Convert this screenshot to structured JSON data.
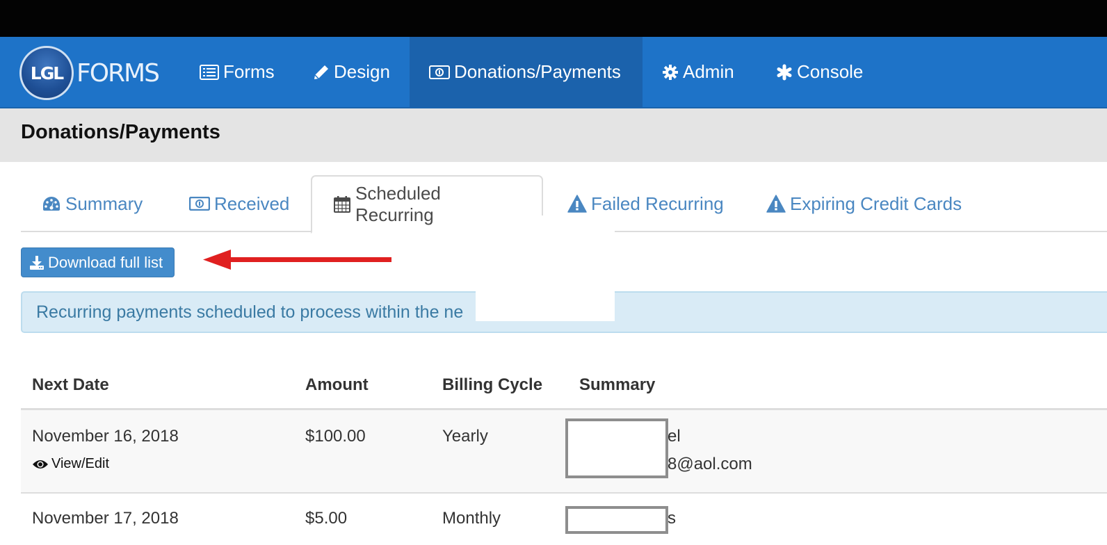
{
  "brand": {
    "logo_mark": "LGL",
    "logo_text": "FORMS"
  },
  "nav": {
    "items": [
      {
        "label": "Forms",
        "icon": "list-icon",
        "active": false
      },
      {
        "label": "Design",
        "icon": "pencil-icon",
        "active": false
      },
      {
        "label": "Donations/Payments",
        "icon": "money-icon",
        "active": true
      },
      {
        "label": "Admin",
        "icon": "gear-icon",
        "active": false
      },
      {
        "label": "Console",
        "icon": "asterisk-icon",
        "active": false
      }
    ]
  },
  "page": {
    "title": "Donations/Payments"
  },
  "tabs": [
    {
      "label": "Summary",
      "icon": "dashboard-icon",
      "active": false
    },
    {
      "label": "Received",
      "icon": "money-icon",
      "active": false
    },
    {
      "label": "Scheduled Recurring",
      "icon": "calendar-icon",
      "active": true
    },
    {
      "label": "Failed Recurring",
      "icon": "warning-icon",
      "active": false
    },
    {
      "label": "Expiring Credit Cards",
      "icon": "warning-icon",
      "active": false
    }
  ],
  "toolbar": {
    "download_label": "Download full list"
  },
  "alert": {
    "text": "Recurring payments scheduled to process within the ne"
  },
  "table": {
    "columns": [
      "Next Date",
      "Amount",
      "Billing Cycle",
      "Summary"
    ],
    "rows": [
      {
        "next_date": "November 16, 2018",
        "amount": "$100.00",
        "billing_cycle": "Yearly",
        "summary_line1": "el",
        "summary_line2": "8@aol.com",
        "action_label": "View/Edit"
      },
      {
        "next_date": "November 17, 2018",
        "amount": "$5.00",
        "billing_cycle": "Monthly",
        "summary_line1": "s"
      }
    ]
  },
  "colors": {
    "nav_bg": "#1e73c8",
    "nav_active_bg": "#1b62ac",
    "link": "#4a87c1",
    "button": "#438ccc",
    "alert_bg": "#d9ebf6",
    "annotation_arrow": "#e02020"
  }
}
